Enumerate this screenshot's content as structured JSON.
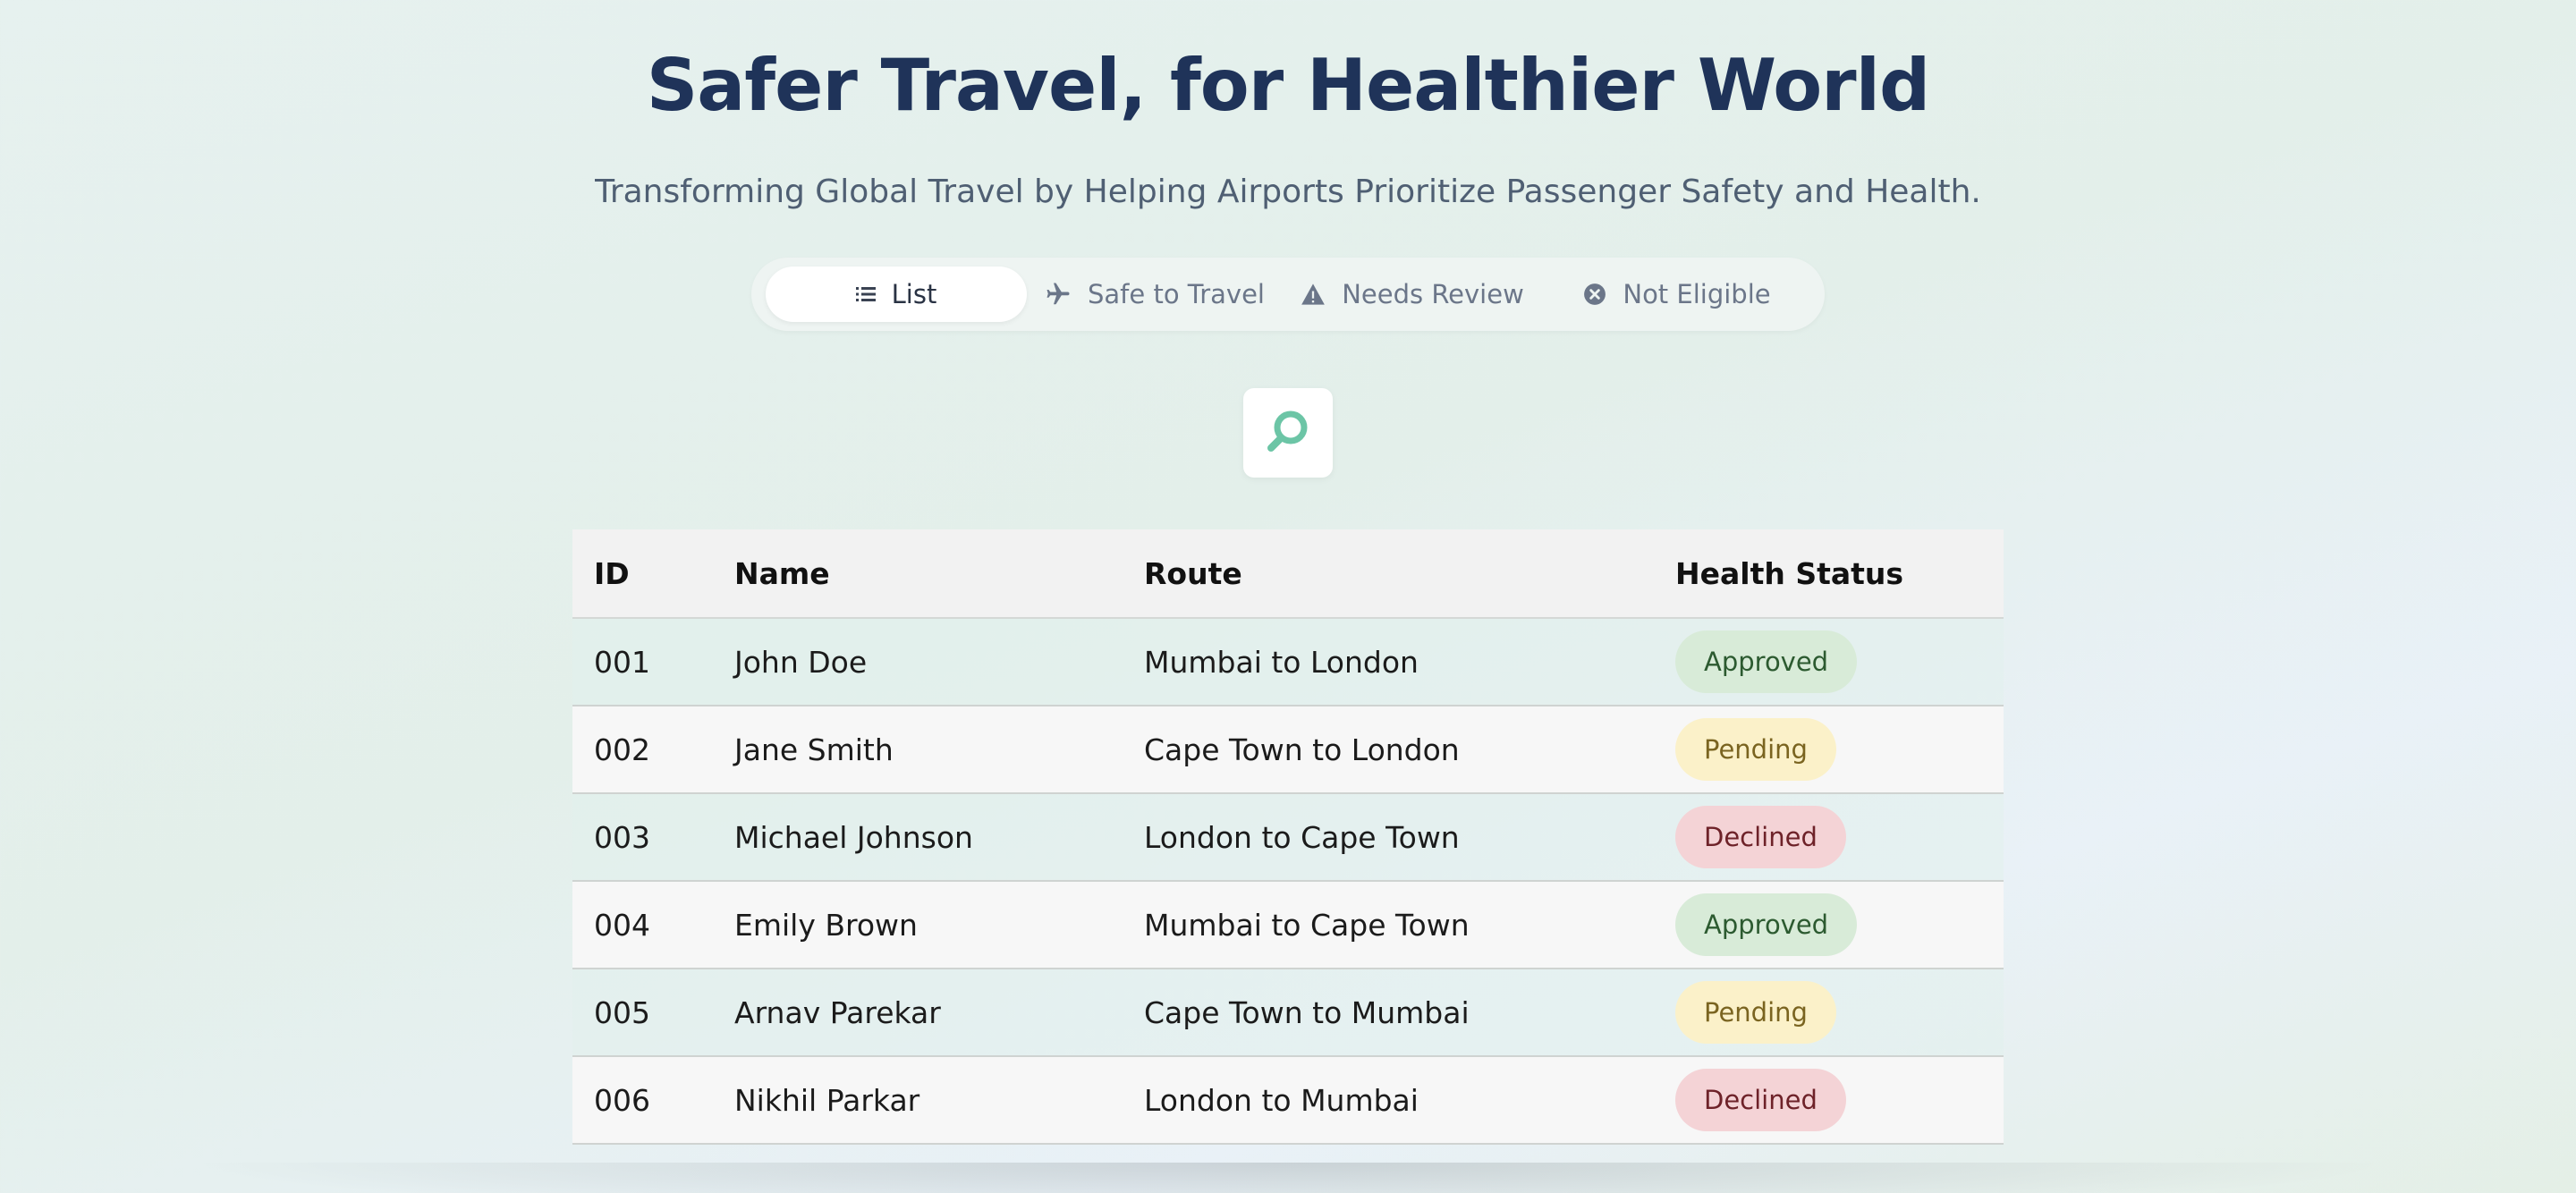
{
  "header": {
    "title": "Safer Travel, for Healthier World",
    "subtitle": "Transforming Global Travel by Helping Airports Prioritize Passenger Safety and Health."
  },
  "tabs": [
    {
      "label": "List",
      "icon": "list-icon",
      "active": true
    },
    {
      "label": "Safe to Travel",
      "icon": "airplane-icon",
      "active": false
    },
    {
      "label": "Needs Review",
      "icon": "warning-icon",
      "active": false
    },
    {
      "label": "Not Eligible",
      "icon": "x-circle-icon",
      "active": false
    }
  ],
  "search": {
    "icon": "search-icon",
    "accent": "#6cc5a6"
  },
  "table": {
    "headers": [
      "ID",
      "Name",
      "Route",
      "Health Status"
    ],
    "rows": [
      {
        "id": "001",
        "name": "John Doe",
        "route": "Mumbai to London",
        "status": "Approved"
      },
      {
        "id": "002",
        "name": "Jane Smith",
        "route": "Cape Town to London",
        "status": "Pending"
      },
      {
        "id": "003",
        "name": "Michael Johnson",
        "route": "London to Cape Town",
        "status": "Declined"
      },
      {
        "id": "004",
        "name": "Emily Brown",
        "route": "Mumbai to Cape Town",
        "status": "Approved"
      },
      {
        "id": "005",
        "name": "Arnav Parekar",
        "route": "Cape Town to Mumbai",
        "status": "Pending"
      },
      {
        "id": "006",
        "name": "Nikhil Parkar",
        "route": "London to Mumbai",
        "status": "Declined"
      }
    ]
  },
  "colors": {
    "title": "#1f3359",
    "approved_bg": "#d8ebd8",
    "pending_bg": "#fbf1c9",
    "declined_bg": "#f4d3d6"
  }
}
